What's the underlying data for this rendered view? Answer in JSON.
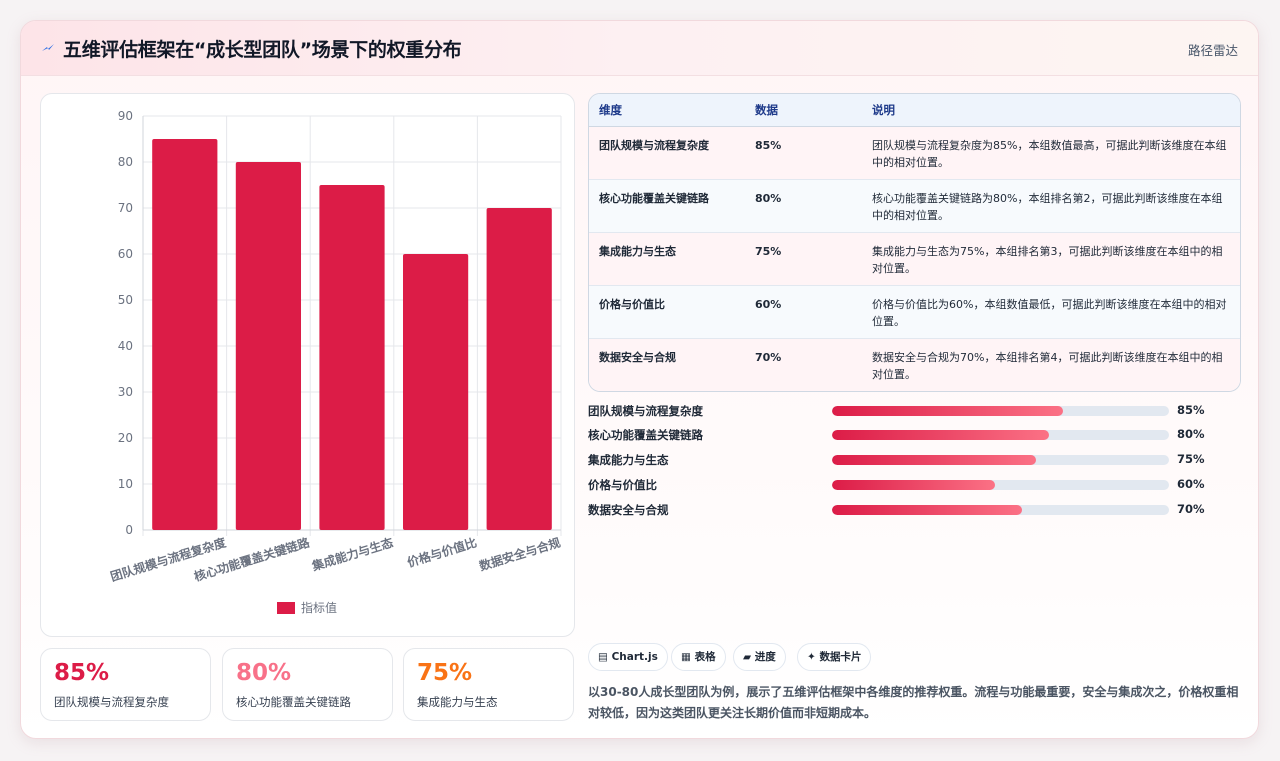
{
  "header": {
    "title": "五维评估框架在“成长型团队”场景下的权重分布",
    "link": "路径雷达"
  },
  "colors": {
    "bar": "#dc1c47",
    "accent_red": "#dc1c47",
    "accent_pink": "#f87189",
    "accent_orange": "#f97316"
  },
  "chart_data": {
    "type": "bar",
    "categories": [
      "团队规模与流程复杂度",
      "核心功能覆盖关键链路",
      "集成能力与生态",
      "价格与价值比",
      "数据安全与合规"
    ],
    "series": [
      {
        "name": "指标值",
        "values": [
          85,
          80,
          75,
          60,
          70
        ]
      }
    ],
    "yticks": [
      "0",
      "10",
      "20",
      "30",
      "40",
      "50",
      "60",
      "70",
      "80",
      "90"
    ],
    "ylim": [
      0,
      90
    ],
    "grid": true,
    "legend": "bottom"
  },
  "stats": [
    {
      "value": "85%",
      "label": "团队规模与流程复杂度",
      "color": "#dc1c47"
    },
    {
      "value": "80%",
      "label": "核心功能覆盖关键链路",
      "color": "#f87189"
    },
    {
      "value": "75%",
      "label": "集成能力与生态",
      "color": "#f97316"
    }
  ],
  "table": {
    "headers": [
      "维度",
      "数据",
      "说明"
    ],
    "rows": [
      {
        "name": "团队规模与流程复杂度",
        "value": "85%",
        "desc": "团队规模与流程复杂度为85%，本组数值最高，可据此判断该维度在本组中的相对位置。"
      },
      {
        "name": "核心功能覆盖关键链路",
        "value": "80%",
        "desc": "核心功能覆盖关键链路为80%，本组排名第2，可据此判断该维度在本组中的相对位置。"
      },
      {
        "name": "集成能力与生态",
        "value": "75%",
        "desc": "集成能力与生态为75%，本组排名第3，可据此判断该维度在本组中的相对位置。"
      },
      {
        "name": "价格与价值比",
        "value": "60%",
        "desc": "价格与价值比为60%，本组数值最低，可据此判断该维度在本组中的相对位置。"
      },
      {
        "name": "数据安全与合规",
        "value": "70%",
        "desc": "数据安全与合规为70%，本组排名第4，可据此判断该维度在本组中的相对位置。"
      }
    ]
  },
  "progress": [
    {
      "label": "团队规模与流程复杂度",
      "value": "85%",
      "fraction": 0.685
    },
    {
      "label": "核心功能覆盖关键链路",
      "value": "80%",
      "fraction": 0.645
    },
    {
      "label": "集成能力与生态",
      "value": "75%",
      "fraction": 0.605
    },
    {
      "label": "价格与价值比",
      "value": "60%",
      "fraction": 0.485
    },
    {
      "label": "数据安全与合规",
      "value": "70%",
      "fraction": 0.565
    }
  ],
  "tags": [
    {
      "label": "▤ Chart.js",
      "icon": "chart-icon"
    },
    {
      "label": "▦ 表格",
      "icon": "table-icon"
    },
    {
      "label": "▰ 进度",
      "icon": "progress-icon"
    },
    {
      "label": "✦ 数据卡片",
      "icon": "card-icon"
    }
  ],
  "description": "以30-80人成长型团队为例，展示了五维评估框架中各维度的推荐权重。流程与功能最重要，安全与集成次之，价格权重相对较低，因为这类团队更关注长期价值而非短期成本。"
}
